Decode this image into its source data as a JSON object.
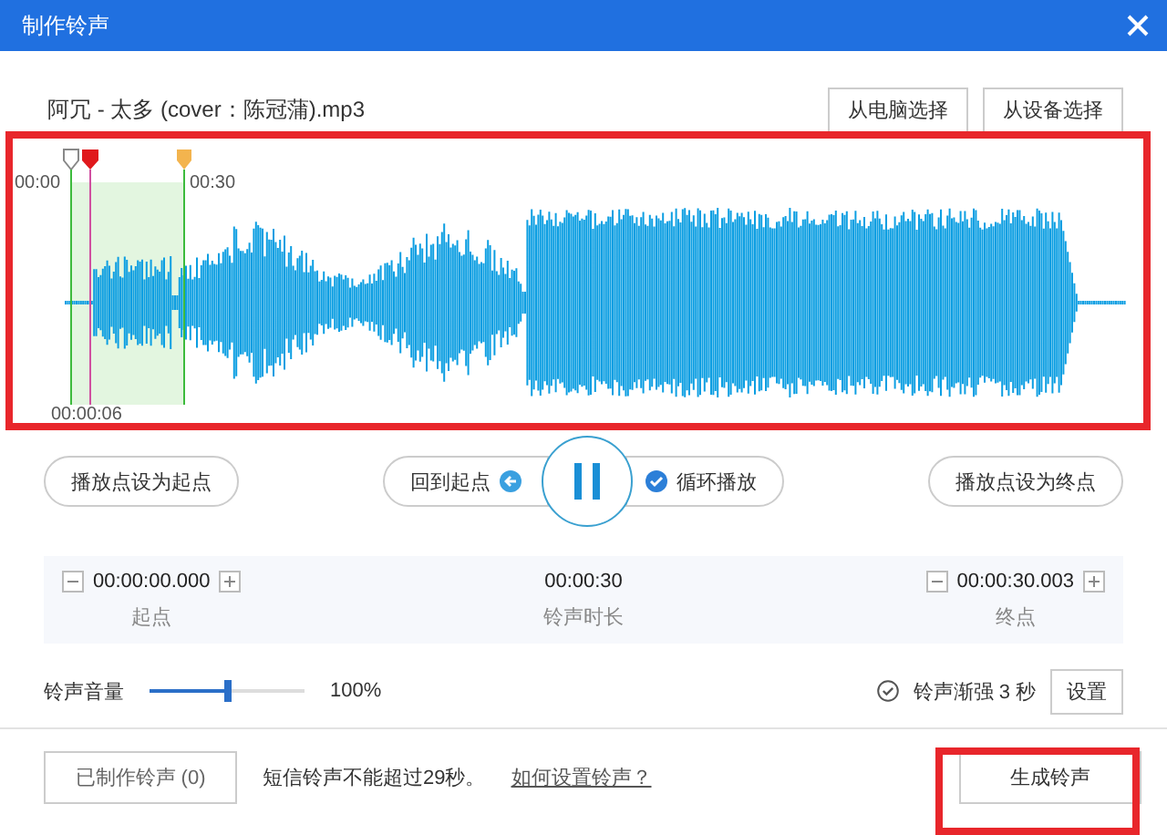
{
  "window": {
    "title": "制作铃声"
  },
  "file": {
    "name": "阿冗 - 太多 (cover：陈冠蒲).mp3"
  },
  "source_buttons": [
    "从电脑选择",
    "从设备选择"
  ],
  "waveform": {
    "time_labels": [
      "00:00",
      "00:30"
    ],
    "playhead_label": "00:00:06"
  },
  "controls": {
    "set_start": "播放点设为起点",
    "back_to_start": "回到起点",
    "loop": {
      "label": "循环播放",
      "checked": true
    },
    "set_end": "播放点设为终点"
  },
  "times": [
    {
      "value": "00:00:00.000",
      "label": "起点",
      "kind": "stepper"
    },
    {
      "value": "00:00:30",
      "label": "铃声时长",
      "kind": "plain"
    },
    {
      "value": "00:00:30.003",
      "label": "终点",
      "kind": "stepper"
    }
  ],
  "volume": {
    "label": "铃声音量",
    "level": 0.5,
    "reading": "100%"
  },
  "fade": {
    "label": "铃声渐强 3 秒",
    "checked": true
  },
  "settings_button": "设置",
  "footer": {
    "made_button": "已制作铃声 (0)",
    "note": "短信铃声不能超过29秒。",
    "help_link": "如何设置铃声？",
    "generate_button": "生成铃声"
  }
}
